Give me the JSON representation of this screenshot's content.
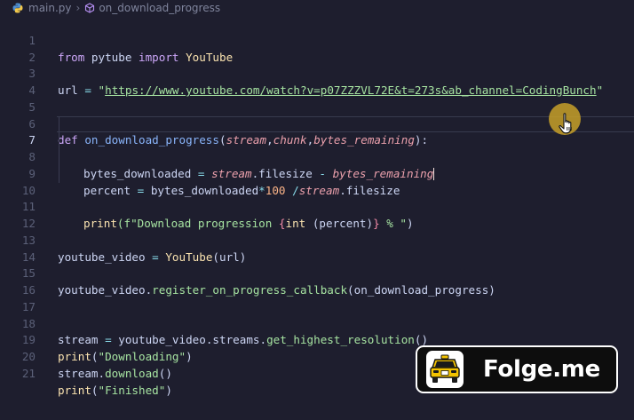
{
  "breadcrumb": {
    "file": "main.py",
    "symbol": "on_download_progress"
  },
  "editor": {
    "current_line": 7,
    "lines": [
      {
        "n": "1"
      },
      {
        "n": "2"
      },
      {
        "n": "3"
      },
      {
        "n": "4"
      },
      {
        "n": "5"
      },
      {
        "n": "6"
      },
      {
        "n": "7"
      },
      {
        "n": "8"
      },
      {
        "n": "9"
      },
      {
        "n": "10"
      },
      {
        "n": "11"
      },
      {
        "n": "12"
      },
      {
        "n": "13"
      },
      {
        "n": "14"
      },
      {
        "n": "15"
      },
      {
        "n": "16"
      },
      {
        "n": "17"
      },
      {
        "n": "18"
      },
      {
        "n": "19"
      },
      {
        "n": "20"
      },
      {
        "n": "21"
      }
    ],
    "tokens": {
      "from": "from",
      "pytube": " pytube ",
      "import": "import",
      "YouTube": " YouTube",
      "url_var": "url ",
      "eq": "=",
      "url_open": " \"",
      "url_value": "https://www.youtube.com/watch?v=p07ZZZVL72E&t=273s&ab_channel=CodingBunch",
      "url_close": "\"",
      "def": "def",
      "fn_name": " on_download_progress",
      "paren_open": "(",
      "p_stream": "stream",
      "comma": ",",
      "p_chunk": "chunk",
      "p_bytes": "bytes_remaining",
      "paren_close_colon": "):",
      "l7_a": "bytes_downloaded ",
      "l7_b": " stream",
      "l7_c": ".filesize ",
      "l7_d": "-",
      "l7_e": " bytes_remaining",
      "l8_a": "percent ",
      "l8_b": " bytes_downloaded",
      "l8_c": "*",
      "l8_d": "100",
      "l8_e": " /",
      "l8_f": "stream",
      "l8_g": ".filesize",
      "print": "print",
      "l10_a": "(f\"Download progression ",
      "l10_b": "{",
      "l10_c": "int",
      "l10_d": " (percent)",
      "l10_e": "}",
      "l10_f": " % \"",
      "l10_g": ")",
      "l13_a": "youtube_video ",
      "l13_b": " YouTube",
      "l13_c": "(url)",
      "l15_a": "youtube_video.",
      "l15_b": "register_on_progress_callback",
      "l15_c": "(on_download_progress)",
      "l18_a": "stream ",
      "l18_b": " youtube_video.streams.",
      "l18_c": "get_highest_resolution",
      "l18_d": "()",
      "l19_a": "(",
      "l19_b": "\"Downloading\"",
      "l19_c": ")",
      "l20_a": "stream.",
      "l20_b": "download",
      "l20_c": "()",
      "l21_b": "\"Finished\""
    }
  },
  "watermark": {
    "brand": "Folge.me"
  },
  "colors": {
    "background": "#1e1e2e",
    "keyword": "#cba6f7",
    "string": "#a6e3a1",
    "function": "#89b4fa",
    "parameter": "#eba0ac",
    "cursor_highlight": "#c7a028"
  }
}
